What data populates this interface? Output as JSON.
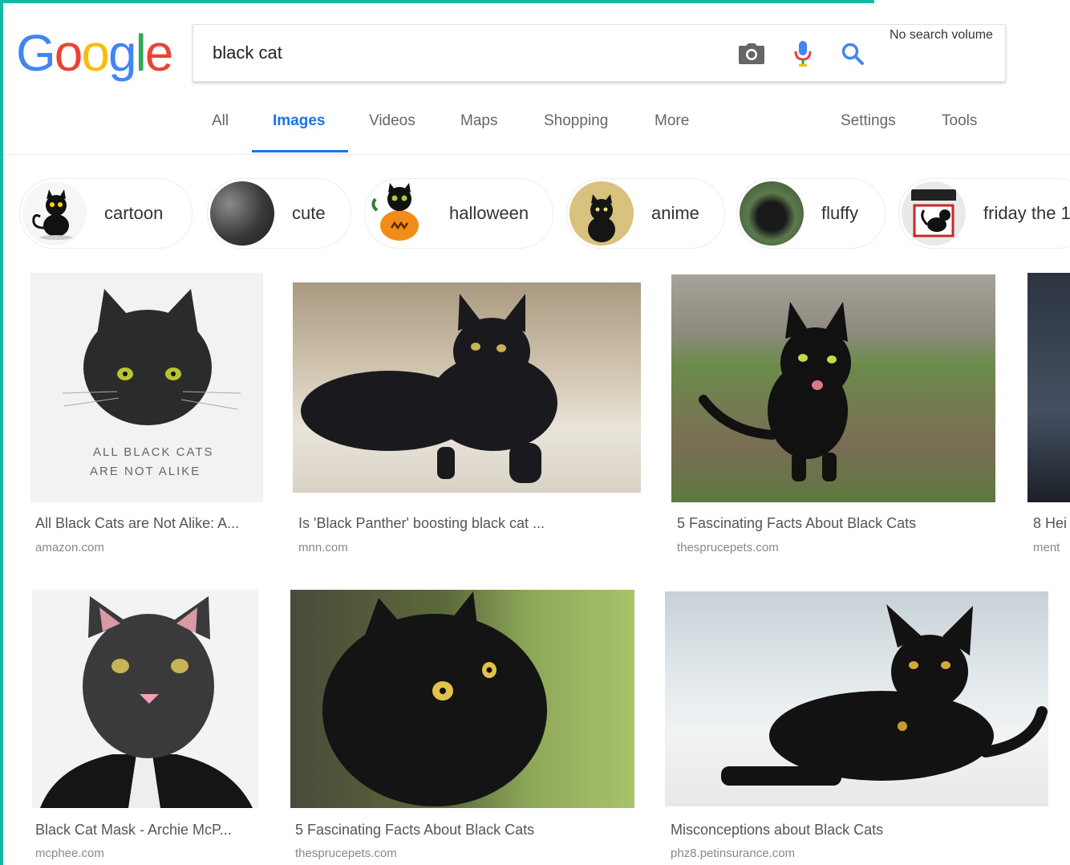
{
  "logo": {
    "letters": [
      "G",
      "o",
      "o",
      "g",
      "l",
      "e"
    ],
    "colors": [
      "#4285F4",
      "#EA4335",
      "#FBBC05",
      "#4285F4",
      "#34A853",
      "#EA4335"
    ]
  },
  "search": {
    "query": "black cat",
    "volume_note": "No search volume"
  },
  "tabs": [
    "All",
    "Images",
    "Videos",
    "Maps",
    "Shopping",
    "More"
  ],
  "tools": {
    "settings": "Settings",
    "tools": "Tools"
  },
  "chips": [
    "cartoon",
    "cute",
    "halloween",
    "anime",
    "fluffy",
    "friday the 1"
  ],
  "results": [
    {
      "caption": "All Black Cats are Not Alike: A...",
      "source": "amazon.com",
      "image_text": [
        "ALL BLACK CATS",
        "ARE NOT ALIKE"
      ]
    },
    {
      "caption": "Is 'Black Panther' boosting black cat ...",
      "source": "mnn.com"
    },
    {
      "caption": "5 Fascinating Facts About Black Cats",
      "source": "thesprucepets.com"
    },
    {
      "caption": "8 Hei",
      "source": "ment"
    },
    {
      "caption": "Black Cat Mask - Archie McP...",
      "source": "mcphee.com"
    },
    {
      "caption": "5 Fascinating Facts About Black Cats",
      "source": "thesprucepets.com"
    },
    {
      "caption": "Misconceptions about Black Cats",
      "source": "phz8.petinsurance.com"
    }
  ],
  "colors": {
    "accent_border": "#14b8a6",
    "active_tab": "#1a73e8",
    "mic_blue": "#4285F4",
    "mic_red": "#EA4335"
  }
}
